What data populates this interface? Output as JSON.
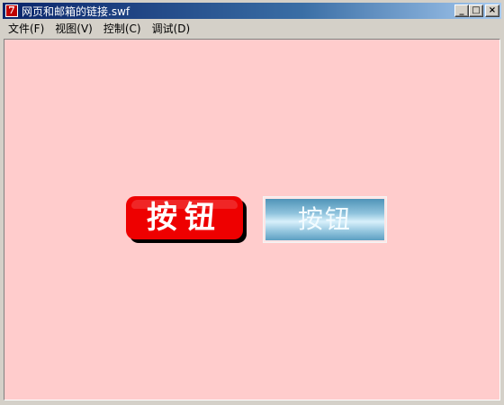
{
  "window": {
    "title": "网页和邮箱的链接.swf",
    "icon_label": "7",
    "controls": {
      "minimize": "_",
      "maximize": "□",
      "close": "×"
    }
  },
  "menubar": {
    "items": [
      {
        "label": "文件(F)"
      },
      {
        "label": "视图(V)"
      },
      {
        "label": "控制(C)"
      },
      {
        "label": "调试(D)"
      }
    ]
  },
  "content": {
    "background": "#ffcccc",
    "red_button": {
      "label": "按钮",
      "color": "#ee0000"
    },
    "blue_button": {
      "label": "按钮",
      "color": "#8fc3dd"
    }
  }
}
